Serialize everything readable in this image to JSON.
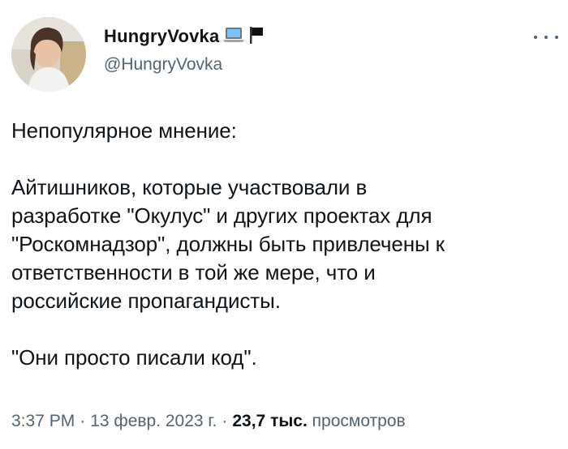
{
  "author": {
    "display_name": "HungryVovka",
    "handle": "@HungryVovka",
    "name_emojis": [
      "laptop-emoji",
      "black-flag-emoji"
    ]
  },
  "tweet": {
    "lines": [
      "Непопулярное мнение:",
      "",
      "Айтишников, которые участвовали в",
      "разработке \"Окулус\" и других проектах для",
      "\"Роскомнадзор\", должны быть привлечены к",
      "ответственности в той же мере, что и",
      "российские пропагандисты.",
      "",
      "\"Они просто писали код\"."
    ]
  },
  "meta": {
    "time": "3:37 PM",
    "date": "13 февр. 2023 г.",
    "separator": "·",
    "views_count": "23,7 тыс.",
    "views_label": "просмотров"
  },
  "colors": {
    "text": "#0f1419",
    "secondary": "#536471",
    "background": "#ffffff"
  }
}
